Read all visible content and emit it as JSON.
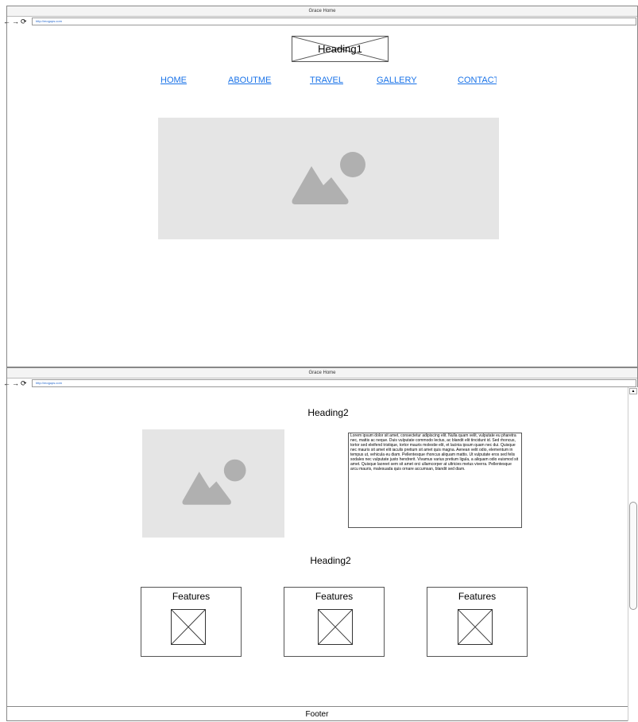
{
  "window1": {
    "title": "Grace Home",
    "url": "http://mogups.com",
    "nav_back": "←",
    "nav_forward": "→",
    "nav_reload": "⟳"
  },
  "window2": {
    "title": "Grace Home",
    "url": "http://mogups.com",
    "nav_back": "←",
    "nav_forward": "→",
    "nav_reload": "⟳"
  },
  "header": {
    "heading1": "Heading1"
  },
  "nav": {
    "items": [
      {
        "label": "HOME"
      },
      {
        "label": "ABOUTME"
      },
      {
        "label": "TRAVEL"
      },
      {
        "label": "GALLERY"
      },
      {
        "label": "CONTACT"
      }
    ]
  },
  "section1": {
    "heading": "Heading2",
    "lorem": "Lorem ipsum dolor sit amet, consectetur adipiscing elit. Nulla quam velit, vulputate eu pharetra nec, mattis ac neque. Duis vulputate commodo lectus, ac blandit elit tincidunt id. Sed rhoncus, tortor sed eleifend tristique, tortor mauris molestie elit, et lacinia ipsum quam nec dui. Quisque nec mauris sit amet elit iaculis pretium sit amet quis magna. Aenean velit odio, elementum in tempus ut, vehicula eu diam. Pellentesque rhoncus aliquam mattis. Ut vulputate eros sed felis sodales nec vulputate justo hendrerit. Vivamus varius pretium ligula, a aliquam odio euismod sit amet. Quisque laoreet sem sit amet orci ullamcorper at ultricies metus viverra. Pellentesque arcu mauris, malesuada quis ornare accumsan, blandit sed diam."
  },
  "section2": {
    "heading": "Heading2",
    "features": [
      {
        "title": "Features"
      },
      {
        "title": "Features"
      },
      {
        "title": "Features"
      }
    ]
  },
  "footer": {
    "label": "Footer"
  },
  "colors": {
    "link": "#1a73e8",
    "placeholder_bg": "#e5e5e5",
    "placeholder_shape": "#b0b0b0"
  }
}
